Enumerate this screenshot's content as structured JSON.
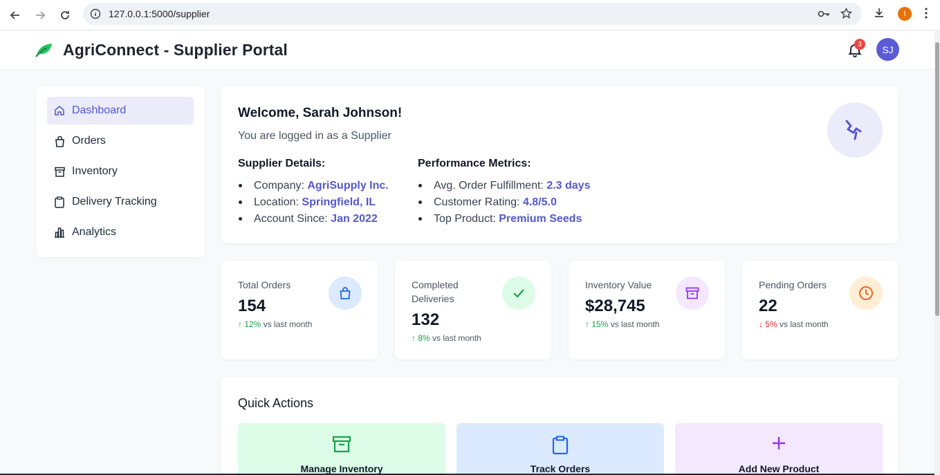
{
  "browser": {
    "url": "127.0.0.1:5000/supplier",
    "profile_initial": "I"
  },
  "header": {
    "title": "AgriConnect - Supplier Portal",
    "notification_count": "3",
    "avatar_initials": "SJ"
  },
  "sidebar": {
    "items": [
      {
        "label": "Dashboard",
        "icon": "home-icon"
      },
      {
        "label": "Orders",
        "icon": "shopping-bag-icon"
      },
      {
        "label": "Inventory",
        "icon": "archive-icon"
      },
      {
        "label": "Delivery Tracking",
        "icon": "clipboard-icon"
      },
      {
        "label": "Analytics",
        "icon": "bar-chart-icon"
      }
    ]
  },
  "welcome": {
    "title": "Welcome, Sarah Johnson!",
    "subtitle": "You are logged in as a Supplier",
    "supplier_heading": "Supplier Details:",
    "supplier_details": [
      {
        "label": "Company: ",
        "value": "AgriSupply Inc."
      },
      {
        "label": "Location: ",
        "value": "Springfield, IL"
      },
      {
        "label": "Account Since: ",
        "value": "Jan 2022"
      }
    ],
    "metrics_heading": "Performance Metrics:",
    "metrics": [
      {
        "label": "Avg. Order Fulfillment: ",
        "value": "2.3 days"
      },
      {
        "label": "Customer Rating: ",
        "value": "4.8/5.0"
      },
      {
        "label": "Top Product: ",
        "value": "Premium Seeds"
      }
    ]
  },
  "stats": [
    {
      "label": "Total Orders",
      "value": "154",
      "trend": "↑ 12%",
      "trend_suffix": " vs last month",
      "icon": "shopping-bag-icon",
      "color": "#2563eb",
      "bg": "#dbeafe"
    },
    {
      "label": "Completed Deliveries",
      "value": "132",
      "trend": "↑ 8%",
      "trend_suffix": " vs last month",
      "icon": "check-icon",
      "color": "#16a34a",
      "bg": "#dcfce7"
    },
    {
      "label": "Inventory Value",
      "value": "$28,745",
      "trend": "↑ 15%",
      "trend_suffix": " vs last month",
      "icon": "archive-icon",
      "color": "#9333ea",
      "bg": "#f3e8ff"
    },
    {
      "label": "Pending Orders",
      "value": "22",
      "trend": "↓ 5%",
      "trend_suffix": " vs last month",
      "icon": "clock-icon",
      "color": "#ea580c",
      "bg": "#ffedd5"
    }
  ],
  "quick_actions": {
    "title": "Quick Actions",
    "items": [
      {
        "label": "Manage Inventory",
        "icon": "archive-icon",
        "color": "#16a34a",
        "bg": "#dcfce7"
      },
      {
        "label": "Track Orders",
        "icon": "clipboard-icon",
        "color": "#2563eb",
        "bg": "#dbeafe"
      },
      {
        "label": "Add New Product",
        "icon": "plus-icon",
        "color": "#9333ea",
        "bg": "#f3e8ff"
      }
    ]
  }
}
